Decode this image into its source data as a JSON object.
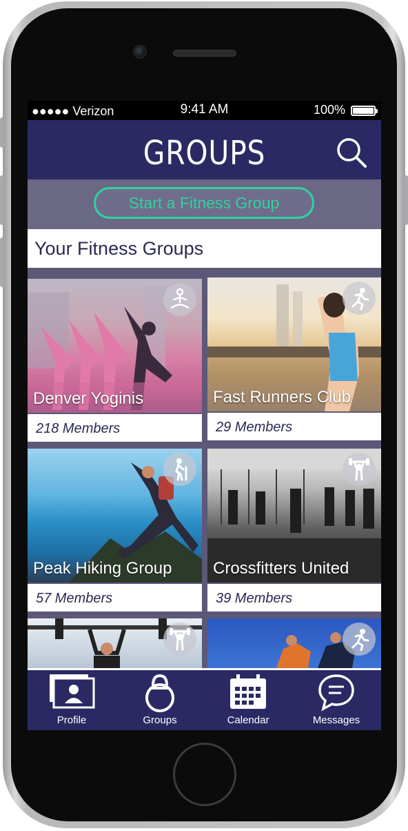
{
  "status_bar": {
    "carrier": "●●●●● Verizon",
    "time": "9:41 AM",
    "battery": "100%"
  },
  "header": {
    "title": "GROUPS",
    "search_icon": "search-icon"
  },
  "start_button": {
    "label": "Start a Fitness Group"
  },
  "section": {
    "title": "Your Fitness Groups"
  },
  "groups": [
    {
      "name": "Denver Yoginis",
      "members": "218 Members",
      "icon": "yoga-icon"
    },
    {
      "name": "Fast Runners Club",
      "members": "29 Members",
      "icon": "running-icon"
    },
    {
      "name": "Peak Hiking Group",
      "members": "57 Members",
      "icon": "hiking-icon"
    },
    {
      "name": "Crossfitters United",
      "members": "39 Members",
      "icon": "weightlifting-icon"
    },
    {
      "name": "",
      "members": "",
      "icon": "weightlifting-icon"
    },
    {
      "name": "",
      "members": "",
      "icon": "running-icon"
    }
  ],
  "tabs": [
    {
      "label": "Profile",
      "icon": "profile-icon"
    },
    {
      "label": "Groups",
      "icon": "kettlebell-icon"
    },
    {
      "label": "Calendar",
      "icon": "calendar-icon"
    },
    {
      "label": "Messages",
      "icon": "chat-icon"
    }
  ],
  "colors": {
    "primary": "#2b2963",
    "accent": "#2fd2a0",
    "band": "#6b6886"
  }
}
